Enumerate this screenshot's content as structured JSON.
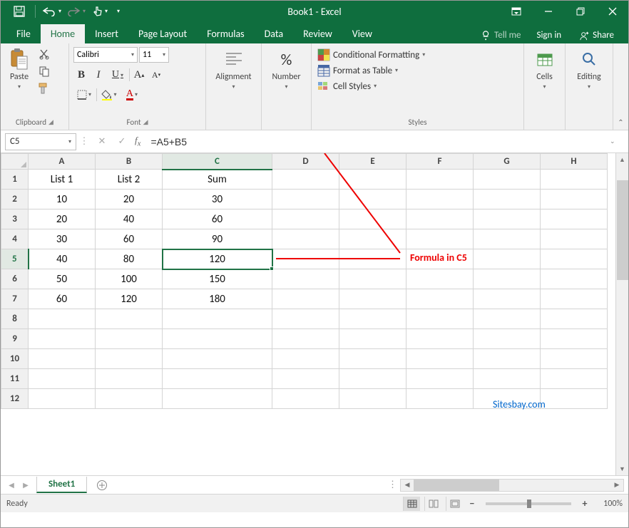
{
  "title": "Book1 - Excel",
  "window": {
    "minimize": "–",
    "restore": "❐",
    "close": "✕"
  },
  "tabs": {
    "file": "File",
    "home": "Home",
    "insert": "Insert",
    "pagelayout": "Page Layout",
    "formulas": "Formulas",
    "data": "Data",
    "review": "Review",
    "view": "View",
    "tellme": "Tell me",
    "signin": "Sign in",
    "share": "Share"
  },
  "ribbon": {
    "clipboard": {
      "paste": "Paste",
      "label": "Clipboard"
    },
    "font": {
      "name": "Calibri",
      "size": "11",
      "label": "Font",
      "bold": "B",
      "italic": "I",
      "underline": "U",
      "incr": "A",
      "decr": "A"
    },
    "alignment": {
      "label": "Alignment",
      "btn": "Alignment"
    },
    "number": {
      "label": "",
      "btn": "Number"
    },
    "styles": {
      "cond": "Conditional Formatting",
      "table": "Format as Table",
      "cell": "Cell Styles",
      "label": "Styles"
    },
    "cells": {
      "btn": "Cells"
    },
    "editing": {
      "btn": "Editing"
    }
  },
  "formula_bar": {
    "name_box": "C5",
    "formula": "=A5+B5"
  },
  "grid": {
    "cols": [
      "A",
      "B",
      "C",
      "D",
      "E",
      "F",
      "G",
      "H"
    ],
    "wide_col_index": 2,
    "rows": 12,
    "selected": {
      "row": 5,
      "col": 2
    },
    "data": [
      [
        "List 1",
        "List 2",
        "Sum",
        "",
        "",
        "",
        "",
        ""
      ],
      [
        "10",
        "20",
        "30",
        "",
        "",
        "",
        "",
        ""
      ],
      [
        "20",
        "40",
        "60",
        "",
        "",
        "",
        "",
        ""
      ],
      [
        "30",
        "60",
        "90",
        "",
        "",
        "",
        "",
        ""
      ],
      [
        "40",
        "80",
        "120",
        "",
        "",
        "",
        "",
        ""
      ],
      [
        "50",
        "100",
        "150",
        "",
        "",
        "",
        "",
        ""
      ],
      [
        "60",
        "120",
        "180",
        "",
        "",
        "",
        "",
        ""
      ],
      [
        "",
        "",
        "",
        "",
        "",
        "",
        "",
        ""
      ],
      [
        "",
        "",
        "",
        "",
        "",
        "",
        "",
        ""
      ],
      [
        "",
        "",
        "",
        "",
        "",
        "",
        "",
        ""
      ],
      [
        "",
        "",
        "",
        "",
        "",
        "",
        "",
        ""
      ],
      [
        "",
        "",
        "",
        "",
        "",
        "",
        "",
        ""
      ]
    ]
  },
  "sheets": {
    "active": "Sheet1"
  },
  "status": {
    "text": "Ready",
    "zoom": "100%"
  },
  "annotations": {
    "formula": "Formula in C5",
    "brand": "Sitesbay.com"
  }
}
